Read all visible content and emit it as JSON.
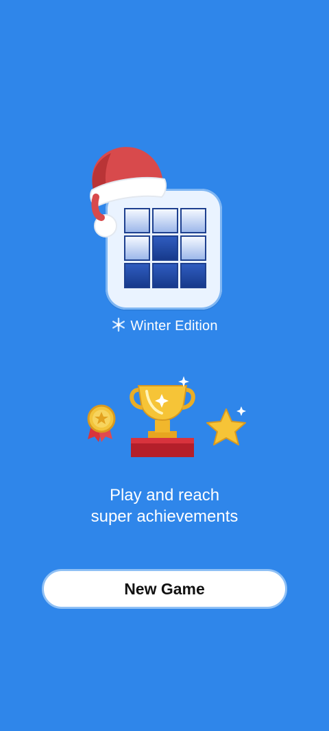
{
  "app": {
    "icon_name": "block-puzzle-icon",
    "hat_icon": "santa-hat-icon",
    "edition_icon": "snowflake-icon",
    "edition_label": "Winter Edition"
  },
  "achievements": {
    "icons": [
      "medal-icon",
      "trophy-icon",
      "star-icon"
    ]
  },
  "tagline": {
    "line1": "Play and reach",
    "line2": "super achievements"
  },
  "actions": {
    "new_game_label": "New Game"
  },
  "colors": {
    "background": "#2f86ea",
    "button_bg": "#ffffff",
    "button_text": "#111111"
  }
}
